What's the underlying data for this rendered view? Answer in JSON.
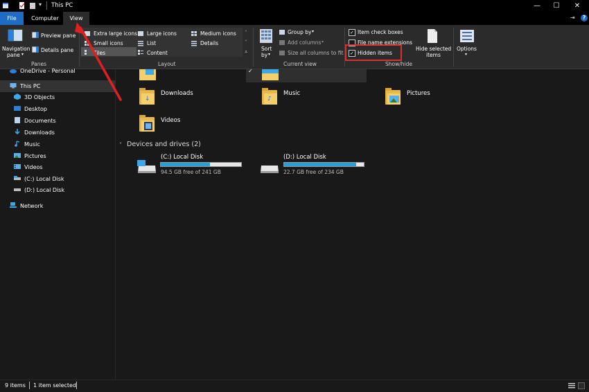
{
  "window": {
    "title": "This PC",
    "buttons": {
      "minimize": "—",
      "maximize": "☐",
      "close": "✕"
    }
  },
  "tabs": [
    {
      "label": "File"
    },
    {
      "label": "Computer"
    },
    {
      "label": "View"
    }
  ],
  "ribbon": {
    "panes": {
      "navigation_pane": "Navigation",
      "navigation_pane_2": "pane",
      "preview_pane": "Preview pane",
      "details_pane": "Details pane",
      "group_label": "Panes"
    },
    "layout": {
      "items": [
        "Extra large icons",
        "Large icons",
        "Medium icons",
        "Small icons",
        "List",
        "Details",
        "Tiles",
        "Content"
      ],
      "group_label": "Layout"
    },
    "current_view": {
      "sort_by": "Sort",
      "sort_by_2": "by",
      "group_by": "Group by",
      "add_columns": "Add columns",
      "size_all_columns": "Size all columns to fit",
      "group_label": "Current view"
    },
    "show_hide": {
      "item_check_boxes": "Item check boxes",
      "file_name_extensions": "File name extensions",
      "hidden_items": "Hidden items",
      "hide_selected_items": "Hide selected",
      "hide_selected_items_2": "items",
      "options": "Options",
      "group_label": "Show/hide",
      "checks": {
        "item_check_boxes": true,
        "file_name_extensions": false,
        "hidden_items": true
      }
    }
  },
  "sidebar": {
    "items": [
      {
        "label": "OneDrive - Personal",
        "icon": "onedrive-icon"
      },
      {
        "label": "This PC",
        "icon": "this-pc-icon",
        "selected": true
      },
      {
        "label": "3D Objects",
        "icon": "3d-objects-icon"
      },
      {
        "label": "Desktop",
        "icon": "desktop-icon"
      },
      {
        "label": "Documents",
        "icon": "documents-icon"
      },
      {
        "label": "Downloads",
        "icon": "downloads-icon"
      },
      {
        "label": "Music",
        "icon": "music-icon"
      },
      {
        "label": "Pictures",
        "icon": "pictures-icon"
      },
      {
        "label": "Videos",
        "icon": "videos-icon"
      },
      {
        "label": "(C:) Local Disk",
        "icon": "drive-icon"
      },
      {
        "label": "(D:) Local Disk",
        "icon": "drive-icon"
      },
      {
        "label": "Network",
        "icon": "network-icon"
      }
    ]
  },
  "content": {
    "folders": [
      {
        "label": "Downloads"
      },
      {
        "label": "Music"
      },
      {
        "label": "Pictures"
      },
      {
        "label": "Videos"
      }
    ],
    "drives_header": "Devices and drives (2)",
    "drives": [
      {
        "label": "(C:) Local Disk",
        "free": "94.5 GB free of 241 GB",
        "used_fraction": 0.61
      },
      {
        "label": "(D:) Local Disk",
        "free": "22.7 GB free of 234 GB",
        "used_fraction": 0.9
      }
    ]
  },
  "status": {
    "count": "9 items",
    "selected": "1 item selected"
  },
  "colors": {
    "accent": "#1e6cc6",
    "highlight": "#d63030",
    "progress": "#26a0da"
  }
}
